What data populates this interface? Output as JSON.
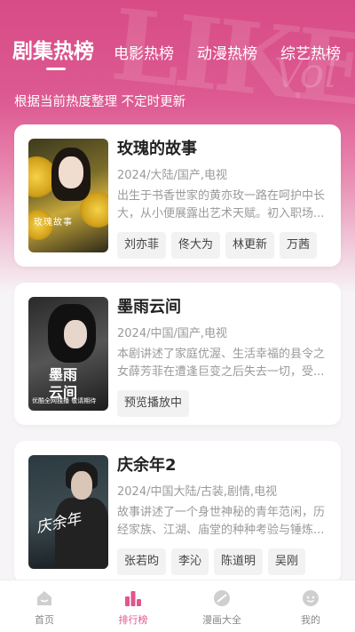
{
  "tabs": [
    {
      "label": "剧集热榜"
    },
    {
      "label": "电影热榜"
    },
    {
      "label": "动漫热榜"
    },
    {
      "label": "综艺热榜"
    }
  ],
  "subtitle": "根据当前热度整理 不定时更新",
  "cards": [
    {
      "title": "玫瑰的故事",
      "meta": "2024/大陆/国产,电视",
      "desc": "出生于书香世家的黄亦玫一路在呵护中长大，从小便展露出艺术天赋。初入职场...",
      "poster_text": "玫瑰故事",
      "tags": [
        "刘亦菲",
        "佟大为",
        "林更新",
        "万茜"
      ]
    },
    {
      "title": "墨雨云间",
      "meta": "2024/中国/国产,电视",
      "desc": "本剧讲述了家庭优渥、生活幸福的县令之女薛芳菲在遭逢巨变之后失去一切，受...",
      "poster_text": "墨雨云间",
      "poster_foot": "优酷全网独播 敬请期待",
      "tags": [
        "预览播放中"
      ]
    },
    {
      "title": "庆余年2",
      "meta": "2024/中国大陆/古装,剧情,电视",
      "desc": "故事讲述了一个身世神秘的青年范闲，历经家族、江湖、庙堂的种种考验与锤炼...",
      "poster_text": "庆余年",
      "tags": [
        "张若昀",
        "李沁",
        "陈道明",
        "吴刚"
      ]
    }
  ],
  "nav": [
    {
      "label": "首页",
      "icon": "home-icon"
    },
    {
      "label": "排行榜",
      "icon": "ranking-icon"
    },
    {
      "label": "漫画大全",
      "icon": "comic-icon"
    },
    {
      "label": "我的",
      "icon": "profile-icon"
    }
  ],
  "colors": {
    "accent": "#e0568f",
    "hero": "#d84b86"
  }
}
